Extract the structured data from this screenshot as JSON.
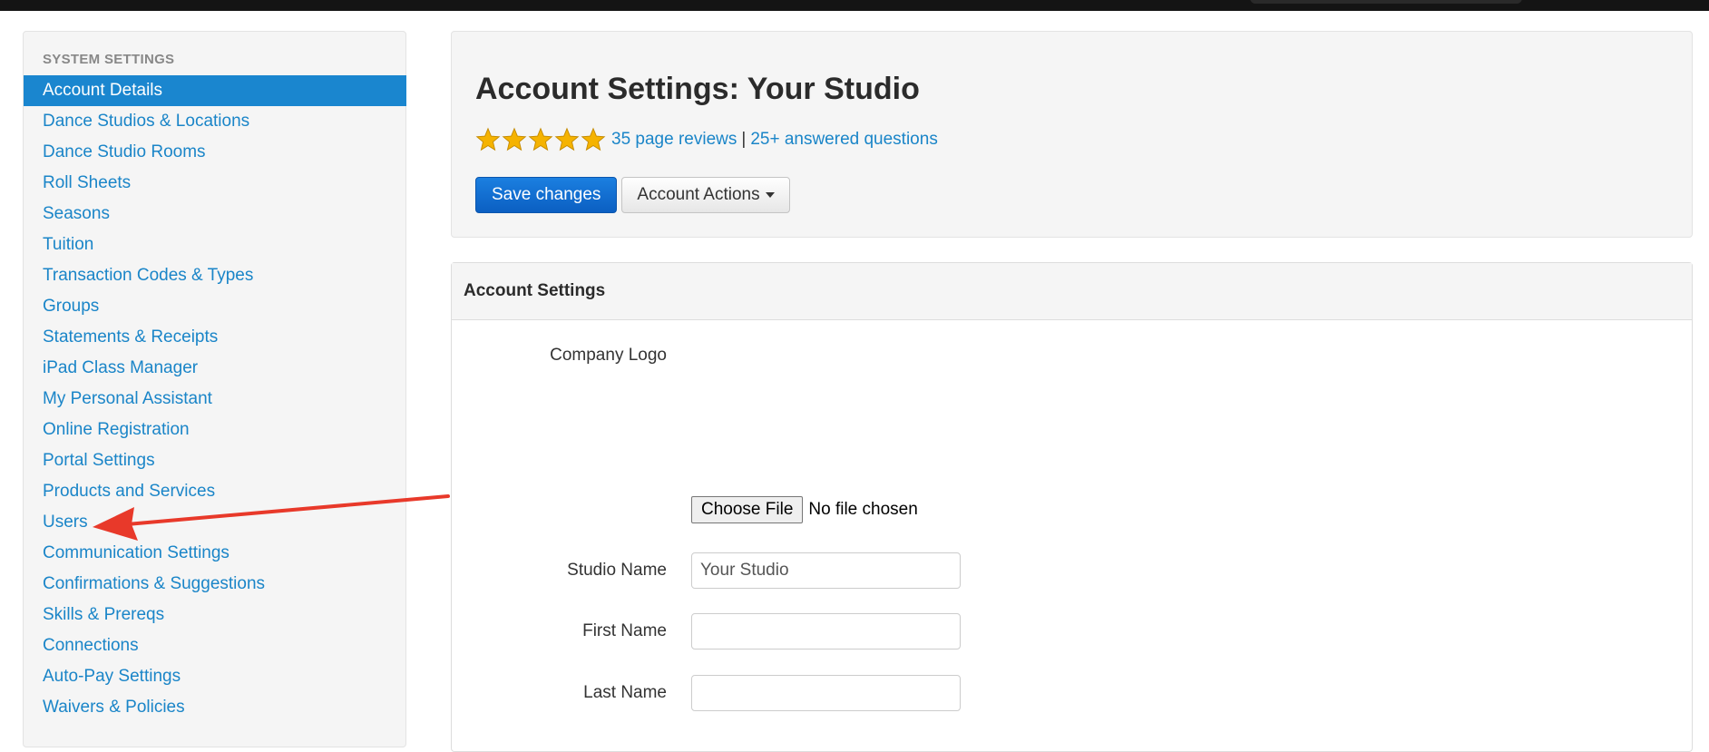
{
  "sidebar": {
    "header": "SYSTEM SETTINGS",
    "items": [
      {
        "label": "Account Details",
        "active": true
      },
      {
        "label": "Dance Studios & Locations"
      },
      {
        "label": "Dance Studio Rooms"
      },
      {
        "label": "Roll Sheets"
      },
      {
        "label": "Seasons"
      },
      {
        "label": "Tuition"
      },
      {
        "label": "Transaction Codes & Types"
      },
      {
        "label": "Groups"
      },
      {
        "label": "Statements & Receipts"
      },
      {
        "label": "iPad Class Manager"
      },
      {
        "label": "My Personal Assistant"
      },
      {
        "label": "Online Registration"
      },
      {
        "label": "Portal Settings"
      },
      {
        "label": "Products and Services"
      },
      {
        "label": "Users"
      },
      {
        "label": "Communication Settings"
      },
      {
        "label": "Confirmations & Suggestions"
      },
      {
        "label": "Skills & Prereqs"
      },
      {
        "label": "Connections"
      },
      {
        "label": "Auto-Pay Settings"
      },
      {
        "label": "Waivers & Policies"
      }
    ]
  },
  "header": {
    "title": "Account Settings: Your Studio",
    "rating": {
      "stars": 5,
      "max_stars": 5,
      "star_color": "#f5b301"
    },
    "reviews_link": "35 page reviews",
    "separator": "|",
    "questions_link": "25+ answered questions",
    "save_button": "Save changes",
    "actions_button": "Account Actions"
  },
  "settings": {
    "heading": "Account Settings",
    "logo_label": "Company Logo",
    "file_button": "Choose File",
    "file_status": "No file chosen",
    "studio_name_label": "Studio Name",
    "studio_name_value": "Your Studio",
    "first_name_label": "First Name",
    "first_name_value": "",
    "last_name_label": "Last Name",
    "last_name_value": ""
  },
  "annotation": {
    "type": "arrow-icon",
    "color": "#e8392a",
    "points_to": "Users"
  },
  "colors": {
    "accent": "#1a86cf",
    "link": "#1a85c8",
    "primary_button": "#0b5fc2",
    "topbar": "#141414"
  }
}
